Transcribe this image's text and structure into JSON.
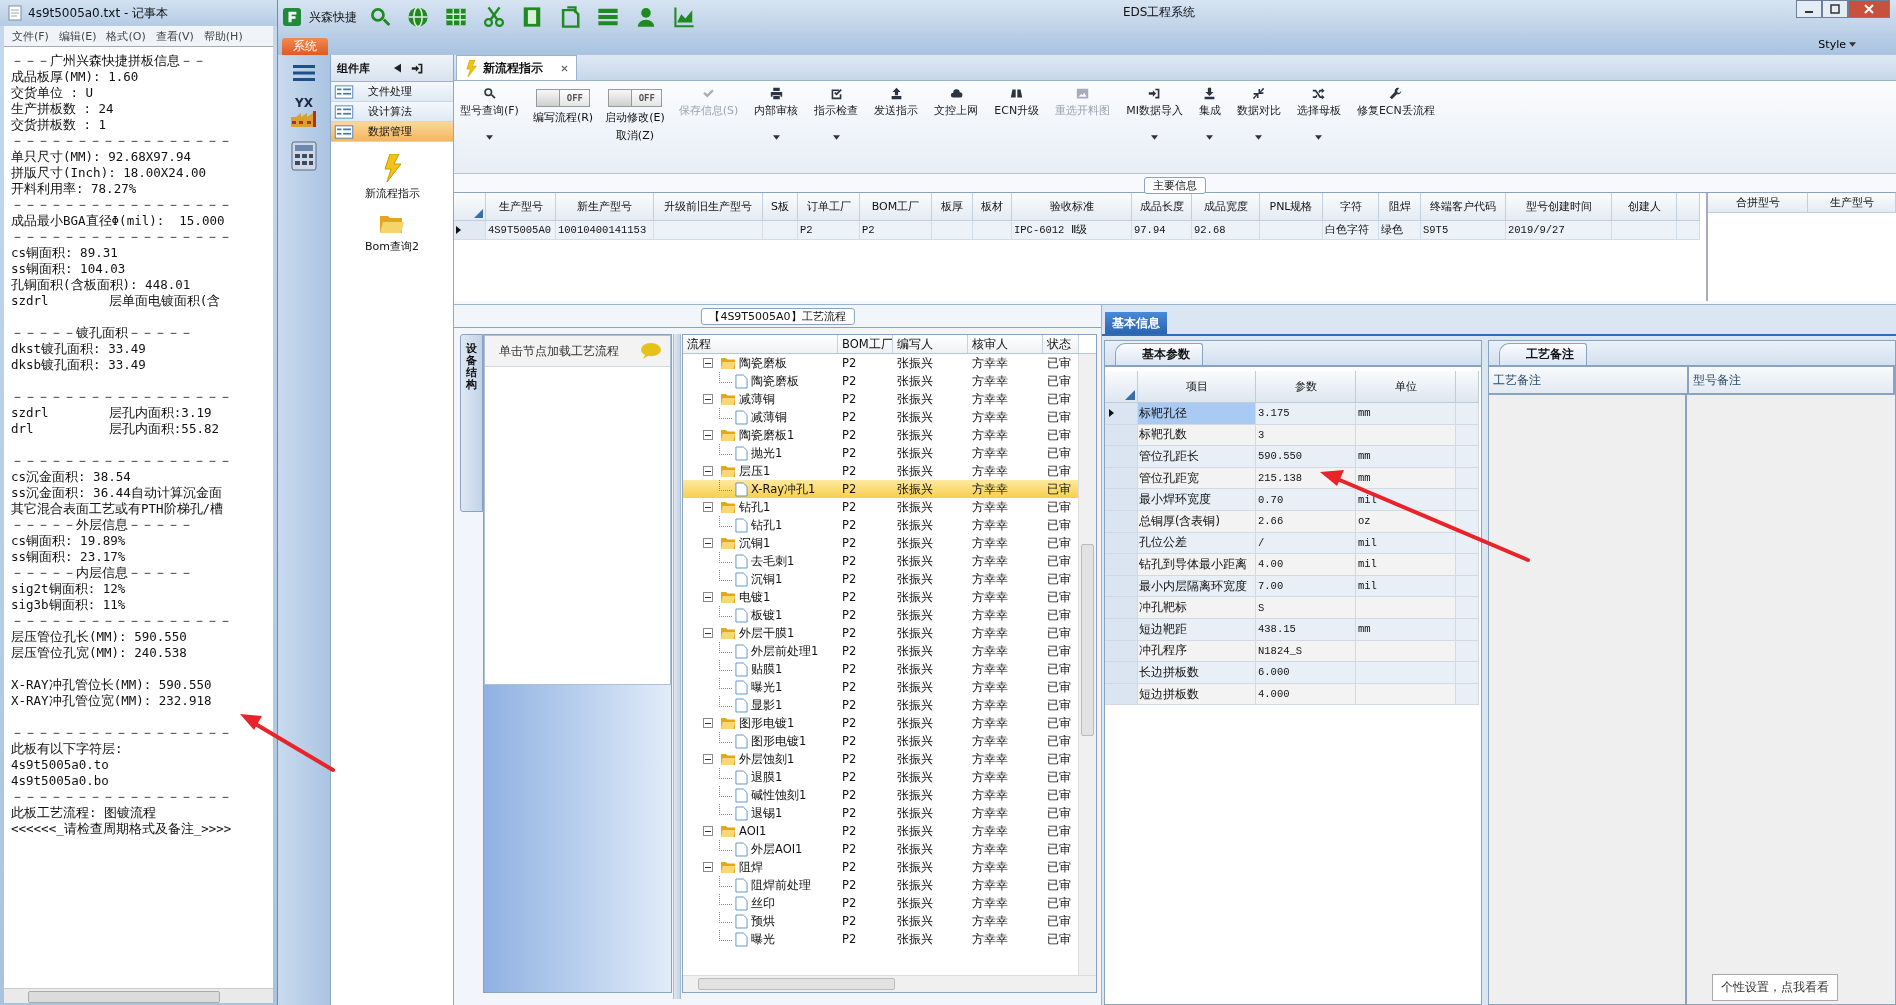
{
  "notepad": {
    "title": "4s9t5005a0.txt - 记事本",
    "menu": [
      "文件(F)",
      "编辑(E)",
      "格式(O)",
      "查看(V)",
      "帮助(H)"
    ],
    "blocks": [
      [
        "－－－广州兴森快捷拼板信息－－",
        "成品板厚(MM): 1.60",
        "交货单位 : U",
        "生产拼板数 : 24",
        "交货拼板数 : 1",
        "－－－－－－－－－－－－－－－－－",
        "单只尺寸(MM): 92.68X97.94",
        "拼版尺寸(Inch): 18.00X24.00",
        "开料利用率: 78.27%",
        "－－－－－－－－－－－－－－－－－",
        "成品最小BGA直径Φ(mil):  15.000",
        "－－－－－－－－－－－－－－－－－",
        "cs铜面积: 89.31",
        "ss铜面积: 104.03",
        "孔铜面积(含板面积): 448.01",
        "szdrl        层单面电镀面积(含"
      ],
      [
        "－－－－－镀孔面积－－－－－",
        "dkst镀孔面积: 33.49",
        "dksb镀孔面积: 33.49"
      ],
      [
        "－－－－－－－－－－－－－－－－－",
        "szdrl        层孔内面积:3.19",
        "drl          层孔内面积:55.82"
      ],
      [
        "－－－－－－－－－－－－－－－－－",
        "cs沉金面积: 38.54",
        "ss沉金面积: 36.44自动计算沉金面",
        "其它混合表面工艺或有PTH阶梯孔/槽",
        "－－－－－外层信息－－－－－",
        "cs铜面积: 19.89%",
        "ss铜面积: 23.17%",
        "－－－－－内层信息－－－－－",
        "sig2t铜面积: 12%",
        "sig3b铜面积: 11%",
        "－－－－－－－－－－－－－－－－－",
        "层压管位孔长(MM): 590.550",
        "层压管位孔宽(MM): 240.538"
      ],
      [
        "X-RAY冲孔管位长(MM): 590.550",
        "X-RAY冲孔管位宽(MM): 232.918"
      ],
      [
        "－－－－－－－－－－－－－－－－－",
        "此板有以下字符层:",
        "4s9t5005a0.to",
        "4s9t5005a0.bo",
        "－－－－－－－－－－－－－－－－－",
        "此板工艺流程: 图镀流程",
        "<<<<<<_请检查周期格式及备注_>>>>"
      ]
    ]
  },
  "app": {
    "brand": "兴森快捷",
    "title": "EDS工程系统",
    "system_tab": "系统",
    "style_menu": "Style"
  },
  "nav": {
    "logo_text": "YX"
  },
  "components": {
    "title": "组件库",
    "groups": [
      {
        "label": "文件处理",
        "selected": false
      },
      {
        "label": "设计算法",
        "selected": false
      },
      {
        "label": "数据管理",
        "selected": true
      }
    ],
    "tools": [
      "新流程指示",
      "Bom查询2"
    ]
  },
  "doc_tab": "新流程指示",
  "ribbon": [
    {
      "kind": "button",
      "label": "型号查询(F)",
      "disabled": false,
      "dropdown": true
    },
    {
      "kind": "toggle",
      "text": "OFF",
      "on": false,
      "label": "编写流程(R)"
    },
    {
      "kind": "toggle",
      "text": "OFF",
      "on": false,
      "label": "启动修改(E)",
      "sublabel": "取消(Z)"
    },
    {
      "kind": "button",
      "label": "保存信息(S)",
      "disabled": true,
      "dropdown": false
    },
    {
      "kind": "button",
      "label": "内部审核",
      "disabled": false,
      "dropdown": true
    },
    {
      "kind": "button",
      "label": "指示检查",
      "disabled": false,
      "dropdown": true
    },
    {
      "kind": "button",
      "label": "发送指示",
      "disabled": false,
      "dropdown": false
    },
    {
      "kind": "button",
      "label": "文控上网",
      "disabled": false,
      "dropdown": false
    },
    {
      "kind": "button",
      "label": "ECN升级",
      "disabled": false,
      "dropdown": false
    },
    {
      "kind": "button",
      "label": "重选开料图",
      "disabled": true,
      "dropdown": false
    },
    {
      "kind": "button",
      "label": "MI数据导入",
      "disabled": false,
      "dropdown": true
    },
    {
      "kind": "button",
      "label": "集成",
      "disabled": false,
      "dropdown": true
    },
    {
      "kind": "button",
      "label": "数据对比",
      "disabled": false,
      "dropdown": true
    },
    {
      "kind": "button",
      "label": "选择母板",
      "disabled": false,
      "dropdown": true
    },
    {
      "kind": "button",
      "label": "修复ECN丢流程",
      "disabled": false,
      "dropdown": false
    }
  ],
  "main_info": {
    "legend": "主要信息",
    "columns": [
      {
        "label": "生产型号",
        "value": "4S9T5005A0"
      },
      {
        "label": "新生产型号",
        "value": "10010400141153"
      },
      {
        "label": "升级前旧生产型号"
      },
      {
        "label": "S板"
      },
      {
        "label": "订单工厂",
        "value": "P2"
      },
      {
        "label": "BOM工厂",
        "value": "P2"
      },
      {
        "label": "板厚"
      },
      {
        "label": "板材"
      },
      {
        "label": "验收标准",
        "value": "IPC-6012 Ⅱ级"
      },
      {
        "label": "成品长度",
        "value": "97.94"
      },
      {
        "label": "成品宽度",
        "value": "92.68"
      },
      {
        "label": "PNL规格"
      },
      {
        "label": "字符",
        "value": "白色字符"
      },
      {
        "label": "阻焊",
        "value": "绿色"
      },
      {
        "label": "终端客户代码",
        "value": "S9T5"
      },
      {
        "label": "型号创建时间",
        "value": "2019/9/27"
      },
      {
        "label": "创建人"
      }
    ],
    "merge_columns": [
      "合拼型号",
      "生产型号"
    ]
  },
  "process_flow": {
    "legend": "【4S9T5005A0】工艺流程",
    "side_tab": "设备结构",
    "hint": "单击节点加载工艺流程",
    "columns": [
      "流程",
      "BOM工厂",
      "编写人",
      "核审人",
      "状态"
    ],
    "nodes": [
      {
        "name": "陶瓷磨板",
        "cells": [
          "P2",
          "张振兴",
          "方幸幸",
          "已审"
        ],
        "expanded": true,
        "selected": false,
        "children": [
          {
            "name": "陶瓷磨板",
            "cells": [
              "P2",
              "张振兴",
              "方幸幸",
              "已审"
            ],
            "selected": false
          }
        ]
      },
      {
        "name": "减薄铜",
        "cells": [
          "P2",
          "张振兴",
          "方幸幸",
          "已审"
        ],
        "expanded": true,
        "selected": false,
        "children": [
          {
            "name": "减薄铜",
            "cells": [
              "P2",
              "张振兴",
              "方幸幸",
              "已审"
            ],
            "selected": false
          }
        ]
      },
      {
        "name": "陶瓷磨板1",
        "cells": [
          "P2",
          "张振兴",
          "方幸幸",
          "已审"
        ],
        "expanded": true,
        "selected": false,
        "children": [
          {
            "name": "抛光1",
            "cells": [
              "P2",
              "张振兴",
              "方幸幸",
              "已审"
            ],
            "selected": false
          }
        ]
      },
      {
        "name": "层压1",
        "cells": [
          "P2",
          "张振兴",
          "方幸幸",
          "已审"
        ],
        "expanded": true,
        "selected": false,
        "children": [
          {
            "name": "X-Ray冲孔1",
            "cells": [
              "P2",
              "张振兴",
              "方幸幸",
              "已审"
            ],
            "selected": true
          }
        ]
      },
      {
        "name": "钻孔1",
        "cells": [
          "P2",
          "张振兴",
          "方幸幸",
          "已审"
        ],
        "expanded": true,
        "selected": false,
        "children": [
          {
            "name": "钻孔1",
            "cells": [
              "P2",
              "张振兴",
              "方幸幸",
              "已审"
            ],
            "selected": false
          }
        ]
      },
      {
        "name": "沉铜1",
        "cells": [
          "P2",
          "张振兴",
          "方幸幸",
          "已审"
        ],
        "expanded": true,
        "selected": false,
        "children": [
          {
            "name": "去毛刺1",
            "cells": [
              "P2",
              "张振兴",
              "方幸幸",
              "已审"
            ],
            "selected": false
          },
          {
            "name": "沉铜1",
            "cells": [
              "P2",
              "张振兴",
              "方幸幸",
              "已审"
            ],
            "selected": false
          }
        ]
      },
      {
        "name": "电镀1",
        "cells": [
          "P2",
          "张振兴",
          "方幸幸",
          "已审"
        ],
        "expanded": true,
        "selected": false,
        "children": [
          {
            "name": "板镀1",
            "cells": [
              "P2",
              "张振兴",
              "方幸幸",
              "已审"
            ],
            "selected": false
          }
        ]
      },
      {
        "name": "外层干膜1",
        "cells": [
          "P2",
          "张振兴",
          "方幸幸",
          "已审"
        ],
        "expanded": true,
        "selected": false,
        "children": [
          {
            "name": "外层前处理1",
            "cells": [
              "P2",
              "张振兴",
              "方幸幸",
              "已审"
            ],
            "selected": false
          },
          {
            "name": "贴膜1",
            "cells": [
              "P2",
              "张振兴",
              "方幸幸",
              "已审"
            ],
            "selected": false
          },
          {
            "name": "曝光1",
            "cells": [
              "P2",
              "张振兴",
              "方幸幸",
              "已审"
            ],
            "selected": false
          },
          {
            "name": "显影1",
            "cells": [
              "P2",
              "张振兴",
              "方幸幸",
              "已审"
            ],
            "selected": false
          }
        ]
      },
      {
        "name": "图形电镀1",
        "cells": [
          "P2",
          "张振兴",
          "方幸幸",
          "已审"
        ],
        "expanded": true,
        "selected": false,
        "children": [
          {
            "name": "图形电镀1",
            "cells": [
              "P2",
              "张振兴",
              "方幸幸",
              "已审"
            ],
            "selected": false
          }
        ]
      },
      {
        "name": "外层蚀刻1",
        "cells": [
          "P2",
          "张振兴",
          "方幸幸",
          "已审"
        ],
        "expanded": true,
        "selected": false,
        "children": [
          {
            "name": "退膜1",
            "cells": [
              "P2",
              "张振兴",
              "方幸幸",
              "已审"
            ],
            "selected": false
          },
          {
            "name": "碱性蚀刻1",
            "cells": [
              "P2",
              "张振兴",
              "方幸幸",
              "已审"
            ],
            "selected": false
          },
          {
            "name": "退锡1",
            "cells": [
              "P2",
              "张振兴",
              "方幸幸",
              "已审"
            ],
            "selected": false
          }
        ]
      },
      {
        "name": "AOI1",
        "cells": [
          "P2",
          "张振兴",
          "方幸幸",
          "已审"
        ],
        "expanded": true,
        "selected": false,
        "children": [
          {
            "name": "外层AOI1",
            "cells": [
              "P2",
              "张振兴",
              "方幸幸",
              "已审"
            ],
            "selected": false
          }
        ]
      },
      {
        "name": "阻焊",
        "cells": [
          "P2",
          "张振兴",
          "方幸幸",
          "已审"
        ],
        "expanded": true,
        "selected": false,
        "children": [
          {
            "name": "阻焊前处理",
            "cells": [
              "P2",
              "张振兴",
              "方幸幸",
              "已审"
            ],
            "selected": false
          },
          {
            "name": "丝印",
            "cells": [
              "P2",
              "张振兴",
              "方幸幸",
              "已审"
            ],
            "selected": false
          },
          {
            "name": "预烘",
            "cells": [
              "P2",
              "张振兴",
              "方幸幸",
              "已审"
            ],
            "selected": false
          },
          {
            "name": "曝光",
            "cells": [
              "P2",
              "张振兴",
              "方幸幸",
              "已审"
            ],
            "selected": false
          }
        ]
      }
    ]
  },
  "basic_info": {
    "title": "基本信息",
    "param_tab": "基本参数",
    "param_columns": [
      "项目",
      "参数",
      "单位"
    ],
    "params": [
      {
        "item": "标靶孔径",
        "value": "3.175",
        "unit": "mm",
        "selected": true
      },
      {
        "item": "标靶孔数",
        "value": "3",
        "selected": false
      },
      {
        "item": "管位孔距长",
        "value": "590.550",
        "unit": "mm",
        "selected": false
      },
      {
        "item": "管位孔距宽",
        "value": "215.138",
        "unit": "mm",
        "selected": false
      },
      {
        "item": "最小焊环宽度",
        "value": "0.70",
        "unit": "mil",
        "selected": false
      },
      {
        "item": "总铜厚(含表铜)",
        "value": "2.66",
        "unit": "oz",
        "selected": false
      },
      {
        "item": "孔位公差",
        "value": "/",
        "unit": "mil",
        "selected": false
      },
      {
        "item": "钻孔到导体最小距离",
        "value": "4.00",
        "unit": "mil",
        "selected": false
      },
      {
        "item": "最小内层隔离环宽度",
        "value": "7.00",
        "unit": "mil",
        "selected": false
      },
      {
        "item": "冲孔靶标",
        "value": "S",
        "selected": false
      },
      {
        "item": "短边靶距",
        "value": "438.15",
        "unit": "mm",
        "selected": false
      },
      {
        "item": "冲孔程序",
        "value": "N1824_S",
        "selected": false
      },
      {
        "item": "长边拼板数",
        "value": "6.000",
        "selected": false
      },
      {
        "item": "短边拼板数",
        "value": "4.000",
        "selected": false
      }
    ],
    "notes_tab": "工艺备注",
    "notes_columns": [
      "工艺备注",
      "型号备注"
    ]
  },
  "tooltip": "个性设置，点我看看"
}
